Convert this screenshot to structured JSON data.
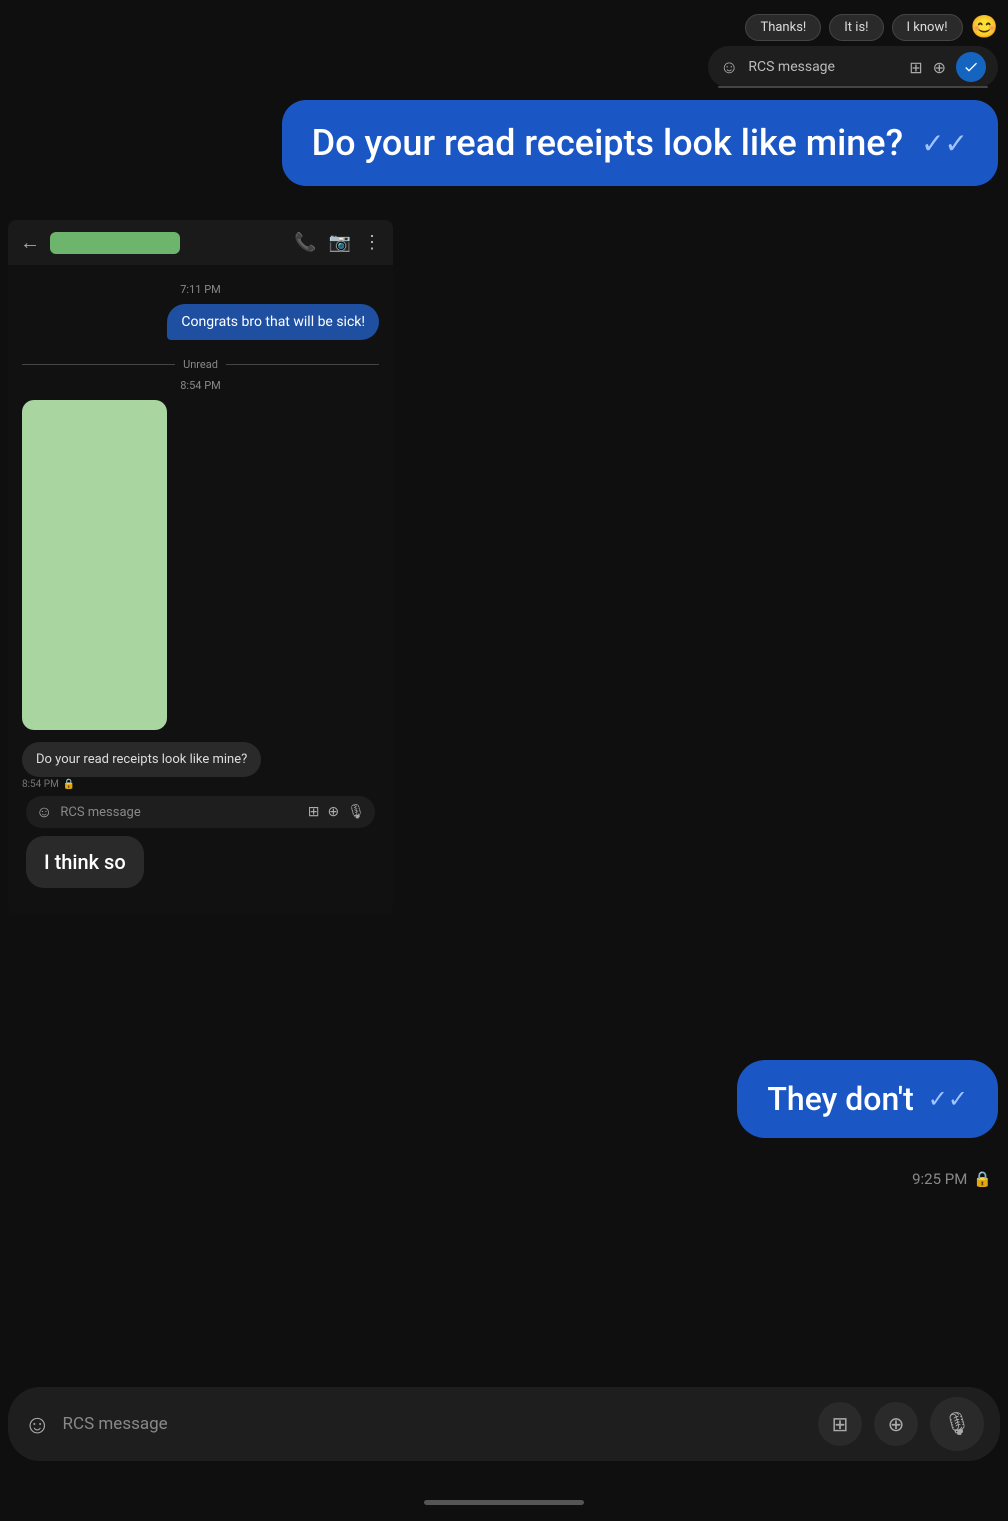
{
  "suggestions": {
    "items": [
      "Thanks!",
      "It is!",
      "I know!"
    ],
    "emoji": "😊"
  },
  "top_input": {
    "placeholder": "RCS message"
  },
  "main_bubble": {
    "text": "Do your read receipts look like mine?",
    "check_symbol": "✓✓"
  },
  "phone": {
    "topbar": {
      "back": "←",
      "contact_placeholder": "",
      "icons": [
        "phone",
        "video",
        "more"
      ]
    },
    "timestamp1": "7:11 PM",
    "congrats_bubble": "Congrats bro that will be sick!",
    "unread_label": "Unread",
    "timestamp2": "8:54 PM",
    "question_bubble": "Do your read receipts look like mine?",
    "bubble_meta": "8:54 PM",
    "rcs_placeholder": "RCS message"
  },
  "think_so": {
    "text": "I think so"
  },
  "they_dont": {
    "text": "They don't",
    "check": "✓✓",
    "time": "9:25 PM"
  },
  "bottom_bar": {
    "placeholder": "RCS message"
  },
  "icons": {
    "emoji": "☺",
    "gallery": "🖼",
    "add": "+",
    "mic": "🎤",
    "lock": "🔒",
    "check_double": "✓✓"
  }
}
